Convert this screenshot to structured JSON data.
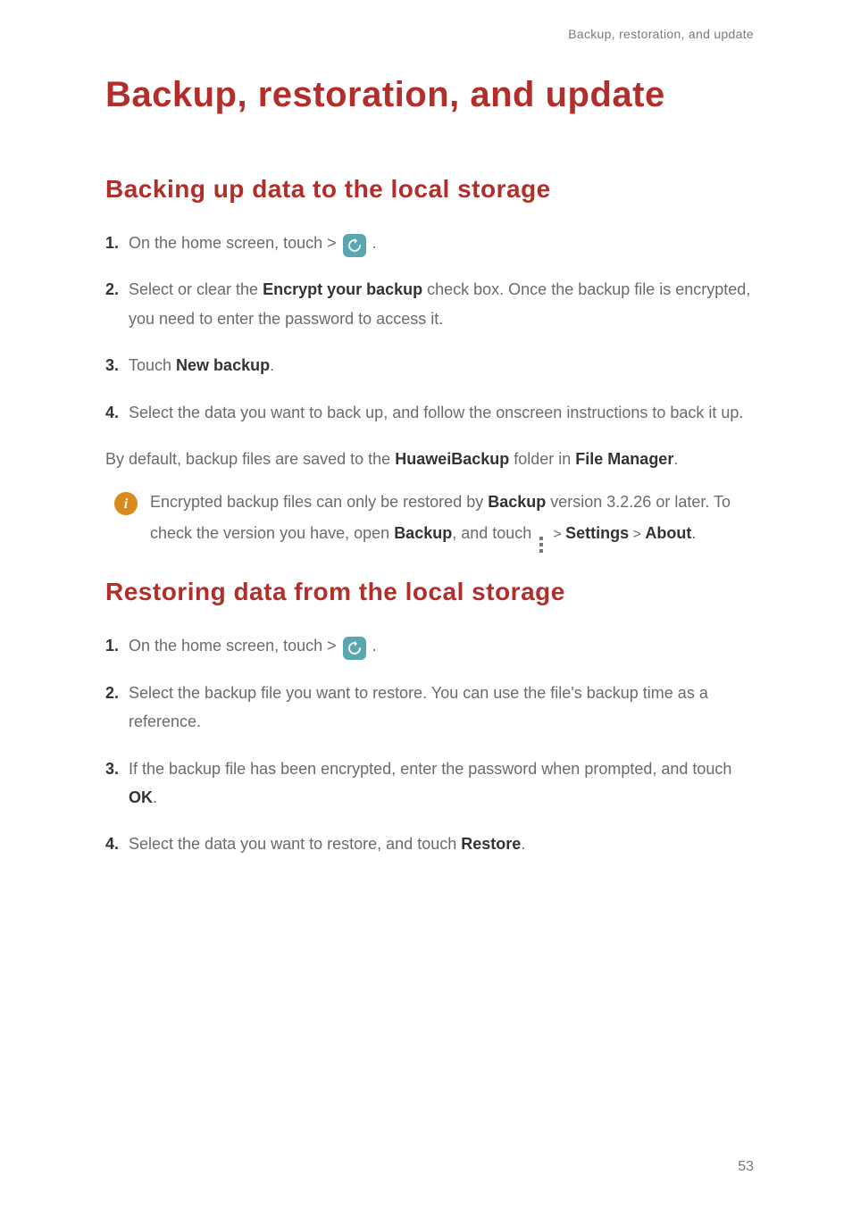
{
  "header": {
    "trail": "Backup, restoration, and update"
  },
  "chapter": {
    "title": "Backup, restoration, and update"
  },
  "section1": {
    "title": "Backing up data to the local storage",
    "steps": [
      {
        "num": "1.",
        "pre": "On the home screen, touch  > ",
        "post": " ."
      },
      {
        "num": "2.",
        "textA": "Select or clear the ",
        "bold1": "Encrypt your backup",
        "textB": " check box. Once the backup file is encrypted, you need to enter the password to access it."
      },
      {
        "num": "3.",
        "textA": "Touch ",
        "bold1": "New backup",
        "textB": "."
      },
      {
        "num": "4.",
        "textA": "Select the data you want to back up, and follow the onscreen instructions to back it up."
      }
    ],
    "tail": {
      "a": "By default, backup files are saved to the ",
      "b": "HuaweiBackup",
      "c": " folder in ",
      "d": "File Manager",
      "e": "."
    },
    "info": {
      "a": "Encrypted backup files can only be restored by ",
      "b": "Backup",
      "c": " version 3.2.26 or later. To check the version you have, open ",
      "d": "Backup",
      "e": ", and touch ",
      "f": "  > ",
      "g": "Settings",
      "h": " > ",
      "i": "About",
      "j": "."
    }
  },
  "section2": {
    "title": "Restoring data from the local storage",
    "steps": [
      {
        "num": "1.",
        "pre": "On the home screen, touch  > ",
        "post": " ."
      },
      {
        "num": "2.",
        "textA": "Select the backup file you want to restore. You can use the file's backup time as a reference."
      },
      {
        "num": "3.",
        "textA": "If the backup file has been encrypted, enter the password when prompted, and touch ",
        "bold1": "OK",
        "textB": "."
      },
      {
        "num": "4.",
        "textA": "Select the data you want to restore, and touch ",
        "bold1": "Restore",
        "textB": "."
      }
    ]
  },
  "page_number": "53",
  "icons": {
    "info": "i",
    "more": "more-vertical-icon",
    "backup": "backup-app-icon"
  }
}
